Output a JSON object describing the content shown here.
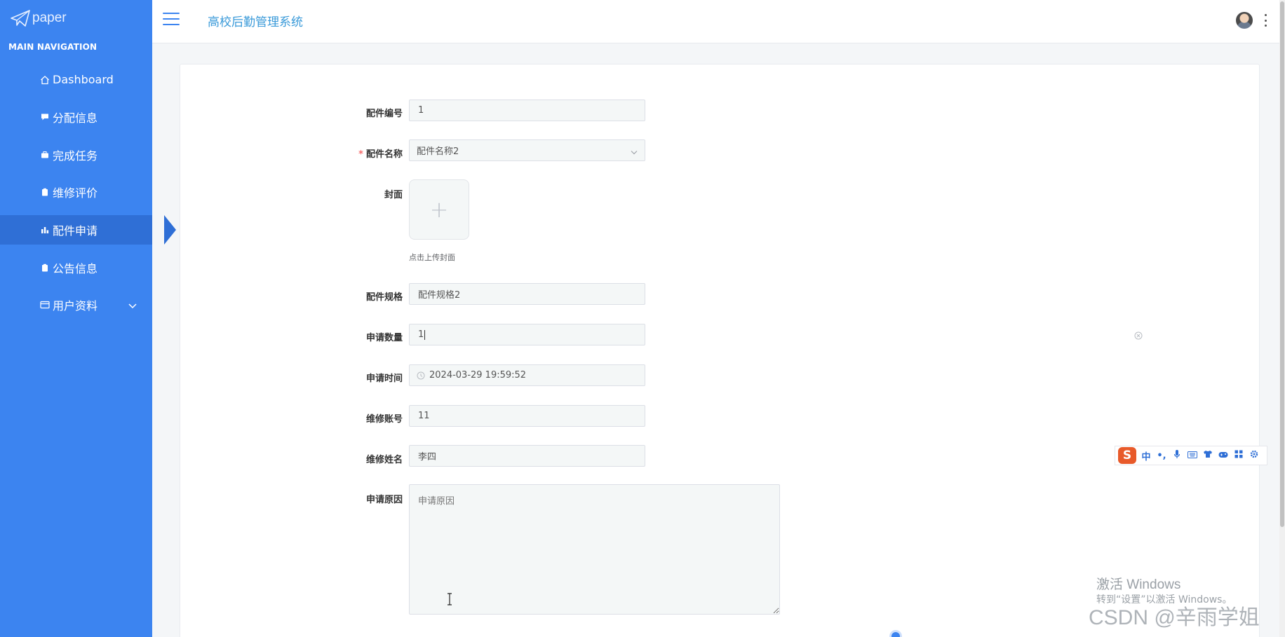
{
  "sidebar": {
    "logo_text": "paper",
    "caption": "MAIN NAVIGATION",
    "items": [
      {
        "label": "Dashboard",
        "icon": "home-icon"
      },
      {
        "label": "分配信息",
        "icon": "comment-icon"
      },
      {
        "label": "完成任务",
        "icon": "briefcase-icon"
      },
      {
        "label": "维修评价",
        "icon": "clipboard-icon"
      },
      {
        "label": "配件申请",
        "icon": "bar-chart-icon",
        "active": true
      },
      {
        "label": "公告信息",
        "icon": "clipboard-icon"
      },
      {
        "label": "用户资料",
        "icon": "card-icon",
        "has_children": true
      }
    ],
    "accent": "#3c84f0"
  },
  "header": {
    "title": "高校后勤管理系统"
  },
  "form": {
    "part_no": {
      "label": "配件编号",
      "value": "1"
    },
    "part_name": {
      "label": "配件名称",
      "value": "配件名称2",
      "required_mark": "*"
    },
    "cover": {
      "label": "封面",
      "hint": "点击上传封面",
      "plus": "+"
    },
    "spec": {
      "label": "配件规格",
      "value": "配件规格2"
    },
    "quantity": {
      "label": "申请数量",
      "value": "1"
    },
    "apply_time": {
      "label": "申请时间",
      "value": "2024-03-29 19:59:52"
    },
    "repair_account": {
      "label": "维修账号",
      "value": "11"
    },
    "repair_name": {
      "label": "维修姓名",
      "value": "李四"
    },
    "reason": {
      "label": "申请原因",
      "placeholder": "申请原因"
    }
  },
  "ime": {
    "logo": "S",
    "mode": "中",
    "punct": "•,"
  },
  "watermark": {
    "windows_title": "激活 Windows",
    "windows_sub": "转到“设置”以激活 Windows。",
    "csdn": "CSDN @辛雨学姐"
  }
}
